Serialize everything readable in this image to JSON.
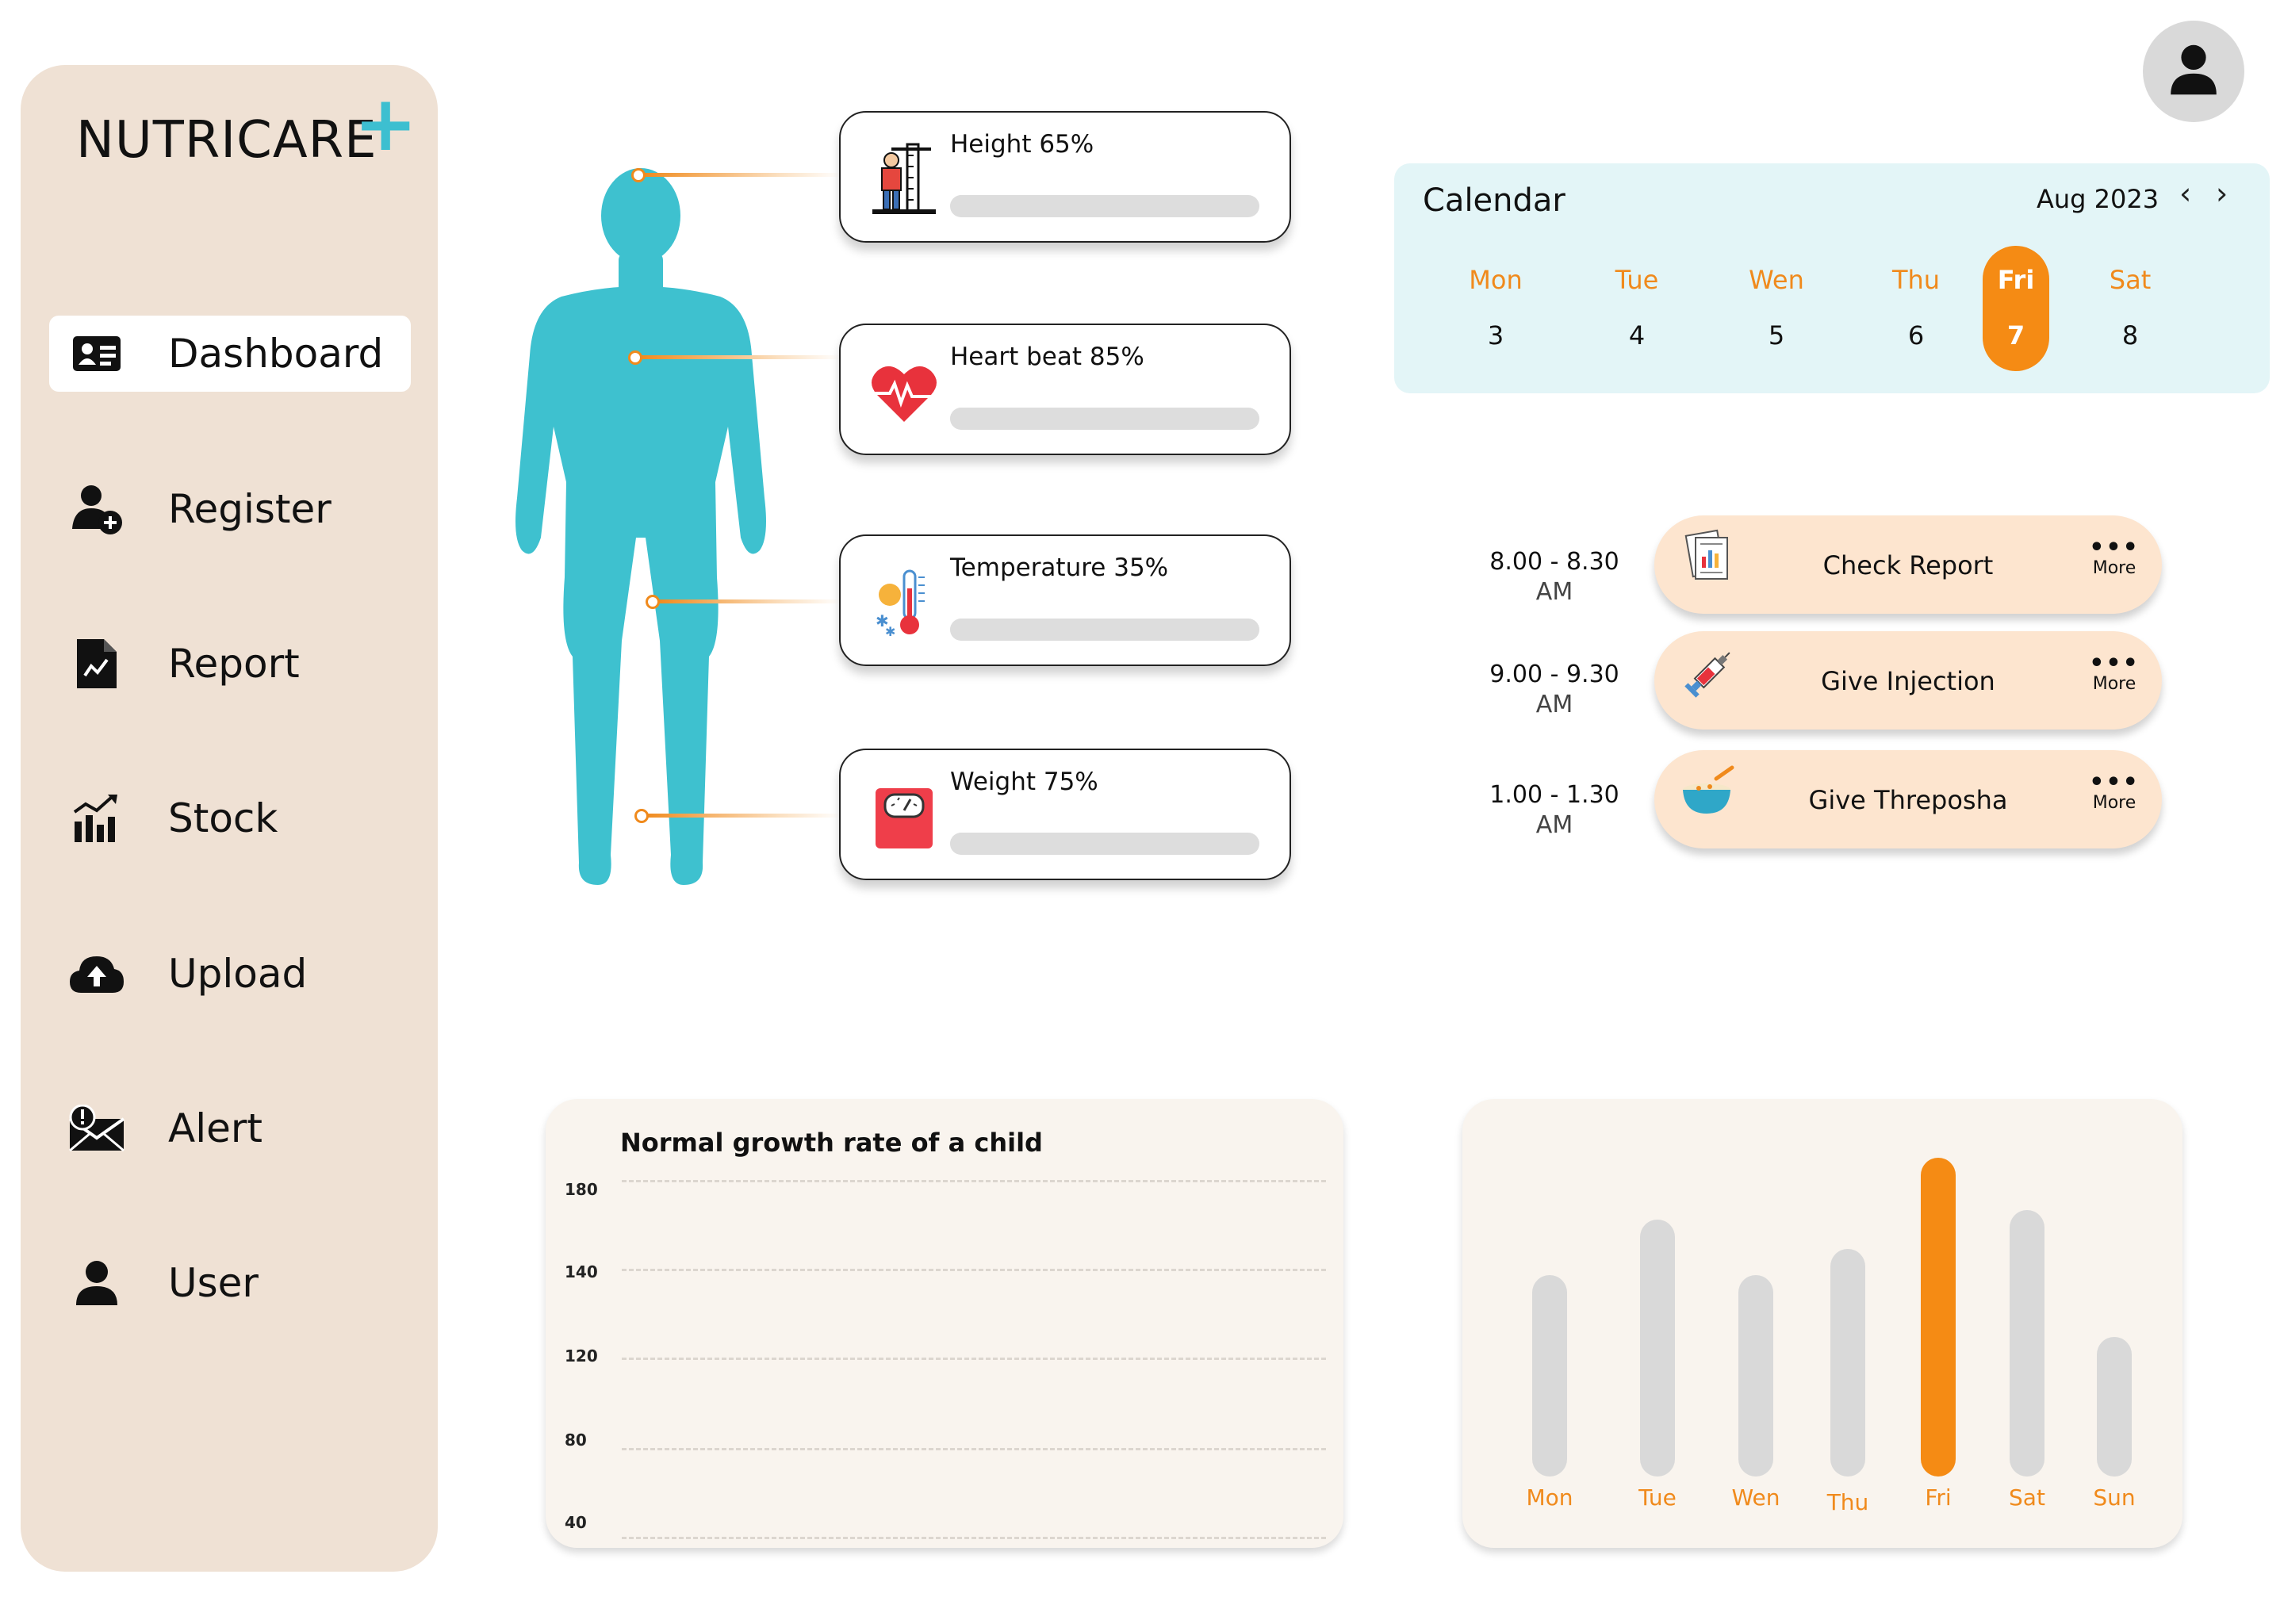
{
  "app": {
    "logo_text": "NUTRICARE",
    "logo_plus": "+",
    "accent_color": "#3dbfd0",
    "highlight_color": "#f58b14"
  },
  "sidebar": {
    "items": [
      {
        "label": "Dashboard",
        "icon": "id-card-icon",
        "active": true
      },
      {
        "label": "Register",
        "icon": "add-user-icon",
        "active": false
      },
      {
        "label": "Report",
        "icon": "report-file-icon",
        "active": false
      },
      {
        "label": "Stock",
        "icon": "stock-chart-icon",
        "active": false
      },
      {
        "label": "Upload",
        "icon": "cloud-upload-icon",
        "active": false
      },
      {
        "label": "Alert",
        "icon": "alert-mail-icon",
        "active": false
      },
      {
        "label": "User",
        "icon": "user-icon",
        "active": false
      }
    ]
  },
  "stats": [
    {
      "label": "Height 65%",
      "icon": "height-measure-icon",
      "progress": 0.65
    },
    {
      "label": "Heart beat 85%",
      "icon": "heartbeat-icon",
      "progress": 0.85
    },
    {
      "label": "Temperature 35%",
      "icon": "thermometer-icon",
      "progress": 0.35
    },
    {
      "label": "Weight 75%",
      "icon": "weighing-scale-icon",
      "progress": 0.75
    }
  ],
  "calendar": {
    "title": "Calendar",
    "month": "Aug 2023",
    "prev": "‹",
    "next": "›",
    "days": [
      {
        "name": "Mon",
        "date": "3"
      },
      {
        "name": "Tue",
        "date": "4"
      },
      {
        "name": "Wen",
        "date": "5"
      },
      {
        "name": "Thu",
        "date": "6"
      },
      {
        "name": "Fri",
        "date": "7",
        "selected": true
      },
      {
        "name": "Sat",
        "date": "8"
      }
    ]
  },
  "schedule": [
    {
      "time": "8.00 - 8.30",
      "period": "AM",
      "task": "Check Report",
      "icon": "report-doc-icon",
      "more": "More"
    },
    {
      "time": "9.00 - 9.30",
      "period": "AM",
      "task": "Give Injection",
      "icon": "syringe-icon",
      "more": "More"
    },
    {
      "time": "1.00 - 1.30",
      "period": "AM",
      "task": "Give Threposha",
      "icon": "food-bowl-icon",
      "more": "More"
    }
  ],
  "growth_chart": {
    "title": "Normal growth rate of a child",
    "ticks": [
      "180",
      "140",
      "120",
      "80",
      "40"
    ]
  },
  "chart_data": [
    {
      "type": "line",
      "title": "Normal growth rate of a child",
      "y_ticks": [
        180,
        140,
        120,
        80,
        40
      ],
      "series": [],
      "grid": true
    },
    {
      "type": "bar",
      "categories": [
        "Mon",
        "Tue",
        "Wen",
        "Thu",
        "Fri",
        "Sat",
        "Sun"
      ],
      "values": [
        0.62,
        0.79,
        0.62,
        0.7,
        0.98,
        0.82,
        0.43
      ],
      "highlight": "Fri",
      "colors": {
        "default": "#d9d9d9",
        "highlight": "#f58b14",
        "label": "#f08a1c"
      }
    }
  ]
}
